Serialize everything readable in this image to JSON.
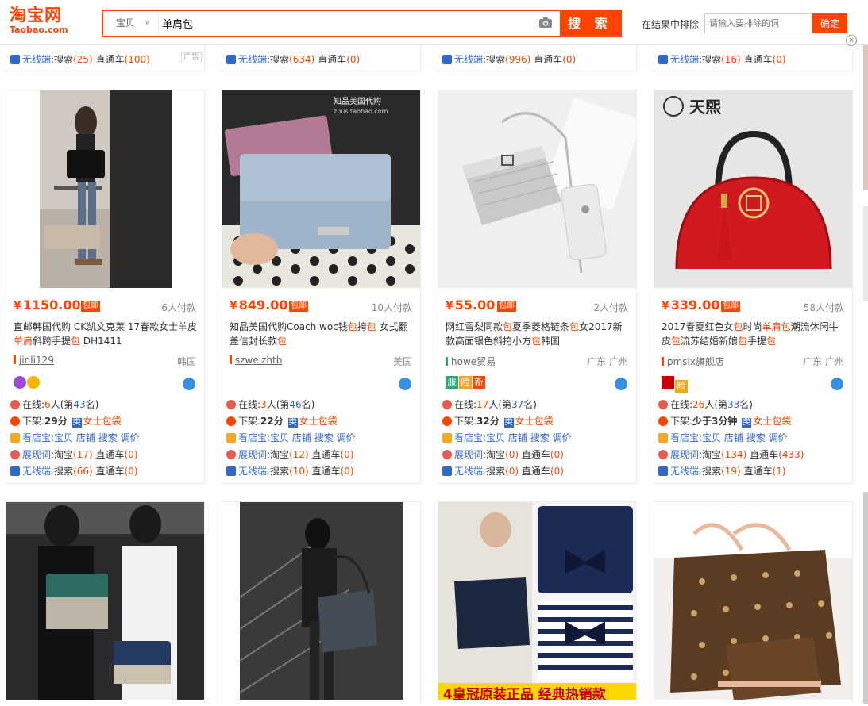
{
  "header": {
    "logo_cn": "淘宝网",
    "logo_en": "Taobao.com",
    "search_scope": "宝贝",
    "query": "单肩包",
    "search_button": "搜 索",
    "exclude_label": "在结果中排除",
    "exclude_placeholder": "请输入要排除的词",
    "exclude_button": "确定",
    "close_symbol": "×"
  },
  "prev_row": {
    "ad_label": "广告",
    "cards": [
      {
        "mobile_label": "无线端",
        "mobile_text": ":搜索",
        "search_count": "(25)",
        "ztc_label": "直通车",
        "ztc_count": "(100)"
      },
      {
        "mobile_label": "无线端",
        "mobile_text": ":搜索",
        "search_count": "(634)",
        "ztc_label": "直通车",
        "ztc_count": "(0)"
      },
      {
        "mobile_label": "无线端",
        "mobile_text": ":搜索",
        "search_count": "(996)",
        "ztc_label": "直通车",
        "ztc_count": "(0)"
      },
      {
        "mobile_label": "无线端",
        "mobile_text": ":搜索",
        "search_count": "(16)",
        "ztc_label": "直通车",
        "ztc_count": "(0)"
      }
    ]
  },
  "products": [
    {
      "price": "1150.00",
      "currency": "¥",
      "baoyou": "包邮",
      "paid": "6人付款",
      "title_html_parts": [
        "直邮韩国代购 CK凯文克莱 17春款女士羊皮",
        "单肩",
        "斜跨手提",
        "包",
        " DH1411"
      ],
      "shop": "jinli129",
      "location": "韩国",
      "online": "6",
      "rank": "43",
      "xiajia": "29分",
      "category": "女士包袋",
      "kandian": "看店宝",
      "kandian_links": ":宝贝 店铺 搜索 调价",
      "zhanxian": "展现词",
      "zx_taobao": ":淘宝",
      "zx_taobao_count": "(17)",
      "zx_ztc": "直通车",
      "zx_ztc_count": "(0)",
      "wuxian": "无线端",
      "wx_search": ":搜索",
      "wx_search_count": "(66)",
      "wx_ztc": "直通车",
      "wx_ztc_count": "(0)"
    },
    {
      "price": "849.00",
      "currency": "¥",
      "baoyou": "包邮",
      "paid": "10人付款",
      "title_html_parts": [
        "知品美国代购Coach woc钱",
        "包",
        "挎",
        "包",
        " 女式翻盖信封长款",
        "包"
      ],
      "shop": "szweizhtb",
      "location": "美国",
      "online": "3",
      "rank": "46",
      "xiajia": "22分",
      "category": "女士包袋",
      "kandian": "看店宝",
      "kandian_links": ":宝贝 店铺 搜索 调价",
      "zhanxian": "展现词",
      "zx_taobao": ":淘宝",
      "zx_taobao_count": "(12)",
      "zx_ztc": "直通车",
      "zx_ztc_count": "(0)",
      "wuxian": "无线端",
      "wx_search": ":搜索",
      "wx_search_count": "(10)",
      "wx_ztc": "直通车",
      "wx_ztc_count": "(0)"
    },
    {
      "price": "55.00",
      "currency": "¥",
      "baoyou": "包邮",
      "paid": "2人付款",
      "title_html_parts": [
        "网红雪梨同款",
        "包",
        "夏季菱格链条",
        "包",
        "女2017新款高面银色斜挎小方",
        "包",
        "韩国"
      ],
      "shop": "howe贸易",
      "location": "广东 广州",
      "online": "17",
      "rank": "37",
      "xiajia": "32分",
      "category": "女士包袋",
      "kandian": "看店宝",
      "kandian_links": ":宝贝 店铺 搜索 调价",
      "zhanxian": "展现词",
      "zx_taobao": ":淘宝",
      "zx_taobao_count": "(0)",
      "zx_ztc": "直通车",
      "zx_ztc_count": "(0)",
      "wuxian": "无线端",
      "wx_search": ":搜索",
      "wx_search_count": "(0)",
      "wx_ztc": "直通车",
      "wx_ztc_count": "(0)",
      "badges": [
        "服",
        "险",
        "新"
      ]
    },
    {
      "price": "339.00",
      "currency": "¥",
      "baoyou": "包邮",
      "paid": "58人付款",
      "title_html_parts": [
        "2017春夏红色女",
        "包",
        "时尚",
        "单肩包",
        "潮流休闲牛皮",
        "包",
        "流苏结婚新娘",
        "包",
        "手提",
        "包"
      ],
      "shop": "pmsix旗舰店",
      "location": "广东 广州",
      "online": "26",
      "rank": "33",
      "xiajia": "少于3分钟",
      "category": "女士包袋",
      "kandian": "看店宝",
      "kandian_links": ":宝贝 店铺 搜索 调价",
      "zhanxian": "展现词",
      "zx_taobao": ":淘宝",
      "zx_taobao_count": "(134)",
      "zx_ztc": "直通车",
      "zx_ztc_count": "(433)",
      "wuxian": "无线端",
      "wx_search": ":搜索",
      "wx_search_count": "(19)",
      "wx_ztc": "直通车",
      "wx_ztc_count": "(1)",
      "badges": [
        "险"
      ]
    }
  ],
  "labels": {
    "online_prefix": "在线:",
    "online_mid": "人(第",
    "online_suffix": "名)",
    "xiajia_prefix": "下架:",
    "category_tag": "类"
  },
  "image_text": {
    "p2_watermark": "知品美国代购",
    "p2_watermark_sub": "zpus.taobao.com",
    "p4_brand": "天煕",
    "p7_banner": "4皇冠原装正品  经典热销款"
  },
  "colors": {
    "accent": "#ff4400",
    "link": "#3366cc"
  }
}
